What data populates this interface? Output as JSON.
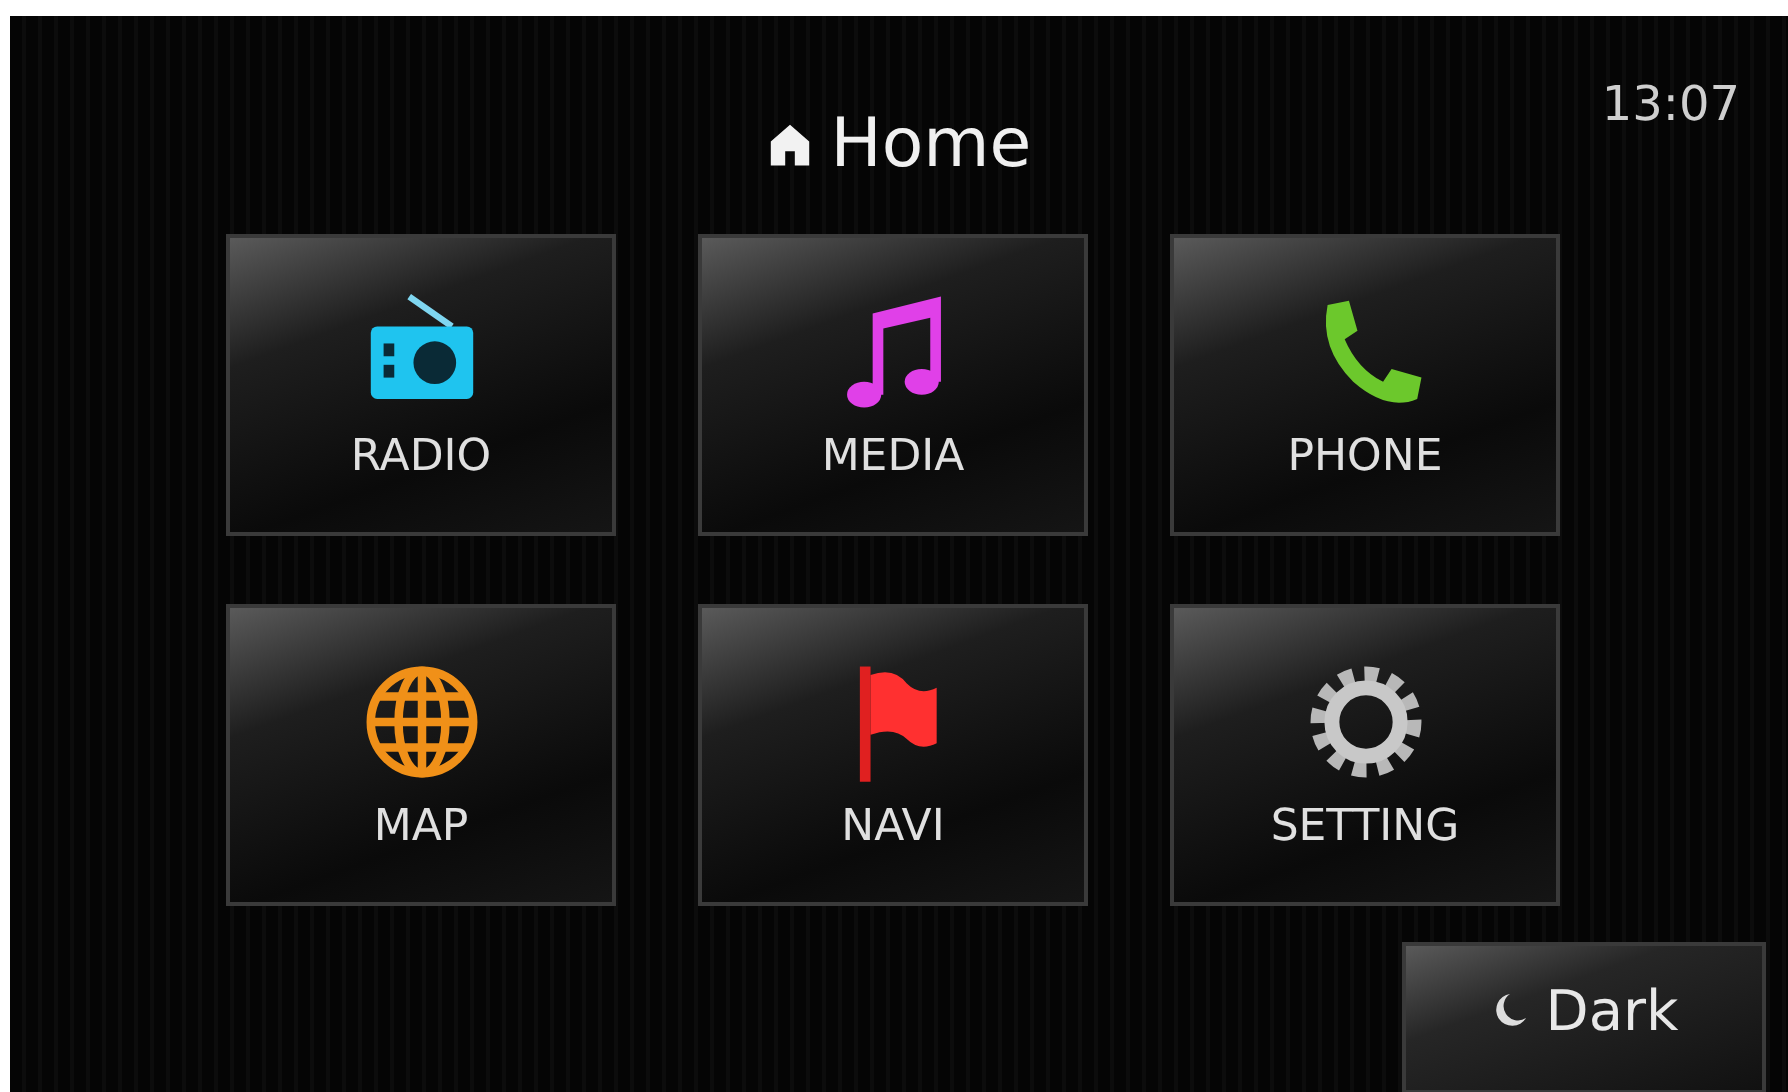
{
  "header": {
    "title": "Home",
    "time": "13:07"
  },
  "tiles": [
    {
      "label": "RADIO",
      "kind": "radio"
    },
    {
      "label": "MEDIA",
      "kind": "music"
    },
    {
      "label": "PHONE",
      "kind": "phone"
    },
    {
      "label": "MAP",
      "kind": "globe"
    },
    {
      "label": "NAVI",
      "kind": "flag"
    },
    {
      "label": "SETTING",
      "kind": "gear"
    }
  ],
  "dark_button": {
    "label": "Dark"
  }
}
